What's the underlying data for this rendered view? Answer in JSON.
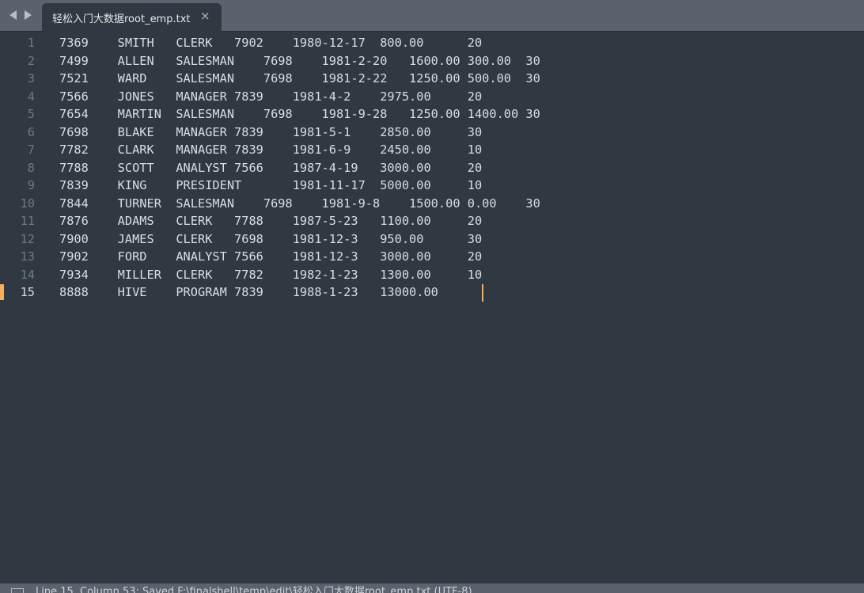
{
  "tab": {
    "title": "轻松入门大数据root_emp.txt",
    "close": "×"
  },
  "editor": {
    "current_line": 15,
    "lines": [
      {
        "number": "1",
        "text": "7369    SMITH   CLERK   7902    1980-12-17  800.00      20"
      },
      {
        "number": "2",
        "text": "7499    ALLEN   SALESMAN    7698    1981-2-20   1600.00 300.00  30"
      },
      {
        "number": "3",
        "text": "7521    WARD    SALESMAN    7698    1981-2-22   1250.00 500.00  30"
      },
      {
        "number": "4",
        "text": "7566    JONES   MANAGER 7839    1981-4-2    2975.00     20"
      },
      {
        "number": "5",
        "text": "7654    MARTIN  SALESMAN    7698    1981-9-28   1250.00 1400.00 30"
      },
      {
        "number": "6",
        "text": "7698    BLAKE   MANAGER 7839    1981-5-1    2850.00     30"
      },
      {
        "number": "7",
        "text": "7782    CLARK   MANAGER 7839    1981-6-9    2450.00     10"
      },
      {
        "number": "8",
        "text": "7788    SCOTT   ANALYST 7566    1987-4-19   3000.00     20"
      },
      {
        "number": "9",
        "text": "7839    KING    PRESIDENT       1981-11-17  5000.00     10"
      },
      {
        "number": "10",
        "text": "7844    TURNER  SALESMAN    7698    1981-9-8    1500.00 0.00    30"
      },
      {
        "number": "11",
        "text": "7876    ADAMS   CLERK   7788    1987-5-23   1100.00     20"
      },
      {
        "number": "12",
        "text": "7900    JAMES   CLERK   7698    1981-12-3   950.00      30"
      },
      {
        "number": "13",
        "text": "7902    FORD    ANALYST 7566    1981-12-3   3000.00     20"
      },
      {
        "number": "14",
        "text": "7934    MILLER  CLERK   7782    1982-1-23   1300.00     10"
      },
      {
        "number": "15",
        "text": "8888    HIVE    PROGRAM 7839    1988-1-23   13000.00"
      }
    ]
  },
  "status": {
    "text": "Line 15, Column 53; Saved F:\\finalshell\\temp\\edit\\轻松入门大数据root_emp.txt (UTF-8)"
  },
  "colors": {
    "background": "#303841",
    "tabbar": "#5a626d",
    "accent": "#f9ae58",
    "text": "#d8dee9"
  },
  "icons": [
    "nav-left-icon",
    "nav-right-icon",
    "close-icon",
    "panel-toggle-icon"
  ]
}
